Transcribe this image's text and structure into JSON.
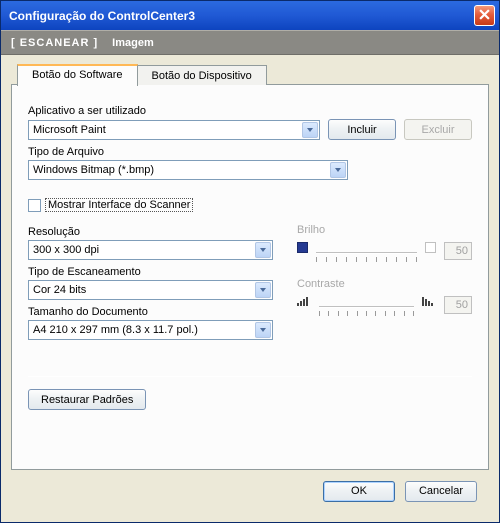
{
  "title": "Configuração do ControlCenter3",
  "subheader": {
    "scan": "[  ESCANEAR  ]",
    "mode": "Imagem"
  },
  "tabs": {
    "software": "Botão do Software",
    "device": "Botão do Dispositivo"
  },
  "labels": {
    "app": "Aplicativo a ser utilizado",
    "filetype": "Tipo de Arquivo",
    "show_iface": "Mostrar Interface do Scanner",
    "resolution": "Resolução",
    "scantype": "Tipo de Escaneamento",
    "docsize": "Tamanho do Documento",
    "brightness": "Brilho",
    "contrast": "Contraste"
  },
  "values": {
    "app": "Microsoft Paint",
    "filetype": "Windows Bitmap (*.bmp)",
    "resolution": "300 x 300 dpi",
    "scantype": "Cor 24 bits",
    "docsize": "A4 210 x 297 mm (8.3 x 11.7 pol.)",
    "brightness": "50",
    "contrast": "50"
  },
  "buttons": {
    "include": "Incluir",
    "exclude": "Excluir",
    "restore": "Restaurar Padrões",
    "ok": "OK",
    "cancel": "Cancelar"
  }
}
